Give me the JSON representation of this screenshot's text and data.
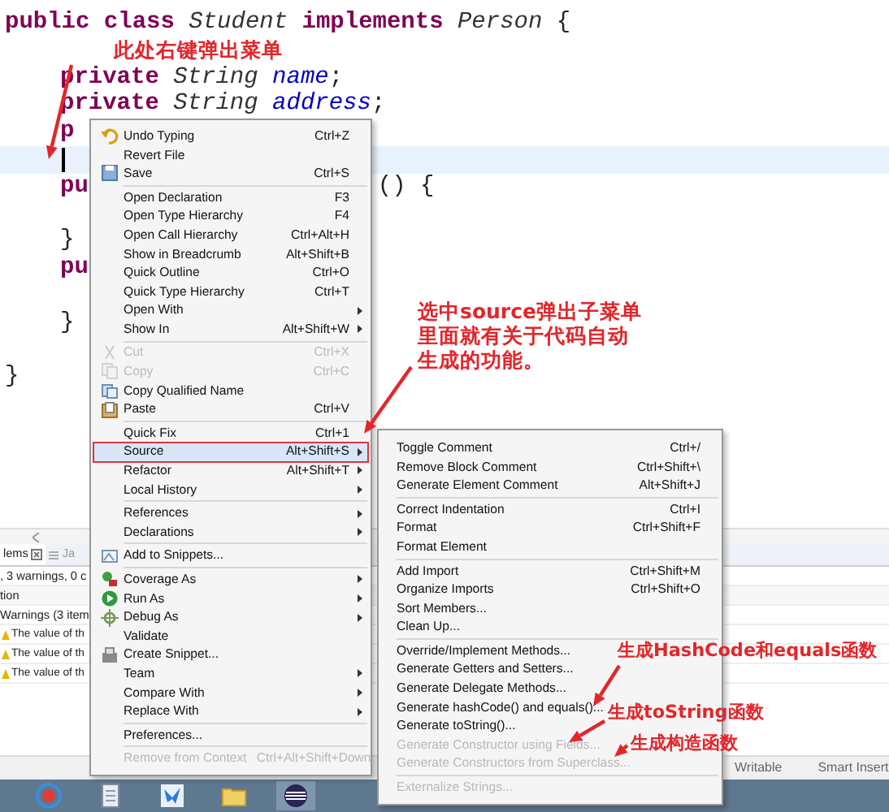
{
  "editor": {
    "lines": [
      {
        "tokens": [
          {
            "text": "public ",
            "kind": "keyword"
          },
          {
            "text": "class ",
            "kind": "keyword"
          },
          {
            "text": "Student ",
            "kind": "type"
          },
          {
            "text": "implements ",
            "kind": "keyword"
          },
          {
            "text": "Person ",
            "kind": "type"
          },
          {
            "text": "{",
            "kind": "plain"
          }
        ]
      },
      {
        "gap_before": true,
        "indented": true,
        "tokens": [
          {
            "text": "private ",
            "kind": "keyword"
          },
          {
            "text": "String ",
            "kind": "type"
          },
          {
            "text": "name",
            "kind": "field"
          },
          {
            "text": ";",
            "kind": "plain"
          }
        ]
      },
      {
        "indented": true,
        "tokens": [
          {
            "text": "private ",
            "kind": "keyword"
          },
          {
            "text": "String ",
            "kind": "type"
          },
          {
            "text": "address",
            "kind": "field"
          },
          {
            "text": ";",
            "kind": "plain"
          }
        ]
      },
      {
        "indented": true,
        "tokens": [
          {
            "text": "p",
            "kind": "keyword"
          }
        ]
      },
      {
        "current": true
      },
      {
        "indented": true,
        "tokens": [
          {
            "text": "pu",
            "kind": "keyword"
          }
        ],
        "after_menu": [
          {
            "text": "() {",
            "kind": "plain"
          }
        ]
      },
      {
        "gap_before": true,
        "indented": true,
        "tokens": [
          {
            "text": "}",
            "kind": "plain"
          }
        ]
      },
      {
        "indented": true,
        "tokens": [
          {
            "text": "pu",
            "kind": "keyword"
          }
        ]
      },
      {
        "gap_before": true,
        "indented": true,
        "tokens": [
          {
            "text": "}",
            "kind": "plain"
          }
        ]
      },
      {
        "gap_before": true,
        "tokens": [
          {
            "text": "}",
            "kind": "plain"
          }
        ]
      }
    ]
  },
  "context_menu": {
    "groups": [
      [
        {
          "label": "Undo Typing",
          "shortcut": "Ctrl+Z",
          "disabled": false,
          "selected": false,
          "submenu": false
        },
        {
          "label": "Revert File",
          "disabled": false,
          "selected": false,
          "submenu": false
        },
        {
          "label": "Save",
          "shortcut": "Ctrl+S",
          "disabled": false,
          "selected": false,
          "submenu": false
        }
      ],
      [
        {
          "label": "Open Declaration",
          "shortcut": "F3",
          "disabled": false,
          "selected": false,
          "submenu": false
        },
        {
          "label": "Open Type Hierarchy",
          "shortcut": "F4",
          "disabled": false,
          "selected": false,
          "submenu": false
        },
        {
          "label": "Open Call Hierarchy",
          "shortcut": "Ctrl+Alt+H",
          "disabled": false,
          "selected": false,
          "submenu": false
        },
        {
          "label": "Show in Breadcrumb",
          "shortcut": "Alt+Shift+B",
          "disabled": false,
          "selected": false,
          "submenu": false
        },
        {
          "label": "Quick Outline",
          "shortcut": "Ctrl+O",
          "disabled": false,
          "selected": false,
          "submenu": false
        },
        {
          "label": "Quick Type Hierarchy",
          "shortcut": "Ctrl+T",
          "disabled": false,
          "selected": false,
          "submenu": false
        },
        {
          "label": "Open With",
          "disabled": false,
          "selected": false,
          "submenu": true
        },
        {
          "label": "Show In",
          "shortcut": "Alt+Shift+W",
          "disabled": false,
          "selected": false,
          "submenu": true
        }
      ],
      [
        {
          "label": "Cut",
          "shortcut": "Ctrl+X",
          "disabled": true,
          "selected": false,
          "submenu": false
        },
        {
          "label": "Copy",
          "shortcut": "Ctrl+C",
          "disabled": true,
          "selected": false,
          "submenu": false
        },
        {
          "label": "Copy Qualified Name",
          "disabled": false,
          "selected": false,
          "submenu": false
        },
        {
          "label": "Paste",
          "shortcut": "Ctrl+V",
          "disabled": false,
          "selected": false,
          "submenu": false
        }
      ],
      [
        {
          "label": "Quick Fix",
          "shortcut": "Ctrl+1",
          "disabled": false,
          "selected": false,
          "submenu": false
        },
        {
          "label": "Source",
          "shortcut": "Alt+Shift+S",
          "disabled": false,
          "selected": true,
          "submenu": true
        },
        {
          "label": "Refactor",
          "shortcut": "Alt+Shift+T",
          "disabled": false,
          "selected": false,
          "submenu": true
        },
        {
          "label": "Local History",
          "disabled": false,
          "selected": false,
          "submenu": true
        }
      ],
      [
        {
          "label": "References",
          "disabled": false,
          "selected": false,
          "submenu": true
        },
        {
          "label": "Declarations",
          "disabled": false,
          "selected": false,
          "submenu": true
        }
      ],
      [
        {
          "label": "Add to Snippets...",
          "disabled": false,
          "selected": false,
          "submenu": false
        }
      ],
      [
        {
          "label": "Coverage As",
          "disabled": false,
          "selected": false,
          "submenu": true
        },
        {
          "label": "Run As",
          "disabled": false,
          "selected": false,
          "submenu": true
        },
        {
          "label": "Debug As",
          "disabled": false,
          "selected": false,
          "submenu": true
        },
        {
          "label": "Validate",
          "disabled": false,
          "selected": false,
          "submenu": false
        },
        {
          "label": "Create Snippet...",
          "disabled": false,
          "selected": false,
          "submenu": false
        },
        {
          "label": "Team",
          "disabled": false,
          "selected": false,
          "submenu": true
        },
        {
          "label": "Compare With",
          "disabled": false,
          "selected": false,
          "submenu": true
        },
        {
          "label": "Replace With",
          "disabled": false,
          "selected": false,
          "submenu": true
        }
      ],
      [
        {
          "label": "Preferences...",
          "disabled": false,
          "selected": false,
          "submenu": false
        }
      ],
      [
        {
          "label": "Remove from Context",
          "shortcut": "Ctrl+Alt+Shift+Down",
          "disabled": true,
          "selected": false
        }
      ]
    ]
  },
  "source_submenu": {
    "groups": [
      [
        {
          "label": "Toggle Comment",
          "shortcut": "Ctrl+/",
          "disabled": false
        },
        {
          "label": "Remove Block Comment",
          "shortcut": "Ctrl+Shift+\\",
          "disabled": false
        },
        {
          "label": "Generate Element Comment",
          "shortcut": "Alt+Shift+J",
          "disabled": false
        }
      ],
      [
        {
          "label": "Correct Indentation",
          "shortcut": "Ctrl+I",
          "disabled": false
        },
        {
          "label": "Format",
          "shortcut": "Ctrl+Shift+F",
          "disabled": false
        },
        {
          "label": "Format Element",
          "disabled": false
        }
      ],
      [
        {
          "label": "Add Import",
          "shortcut": "Ctrl+Shift+M",
          "disabled": false
        },
        {
          "label": "Organize Imports",
          "shortcut": "Ctrl+Shift+O",
          "disabled": false
        },
        {
          "label": "Sort Members...",
          "disabled": false
        },
        {
          "label": "Clean Up...",
          "disabled": false
        }
      ],
      [
        {
          "label": "Override/Implement Methods...",
          "disabled": false
        },
        {
          "label": "Generate Getters and Setters...",
          "disabled": false
        },
        {
          "label": "Generate Delegate Methods...",
          "disabled": false
        },
        {
          "label": "Generate hashCode() and equals()...",
          "disabled": false
        },
        {
          "label": "Generate toString()...",
          "disabled": false
        },
        {
          "label": "Generate Constructor using Fields...",
          "disabled": true
        },
        {
          "label": "Generate Constructors from Superclass...",
          "disabled": true
        }
      ],
      [
        {
          "label": "Externalize Strings...",
          "disabled": true
        }
      ]
    ]
  },
  "problems_panel": {
    "tabs": [
      {
        "label": "lems",
        "selected": true
      },
      {
        "label": "Ja",
        "selected": false
      }
    ],
    "summary": ", 3 warnings, 0 c",
    "column_header": "tion",
    "tree": [
      {
        "label": "Warnings (3 item",
        "children": [
          {
            "label": "The value of th"
          },
          {
            "label": "The value of th"
          },
          {
            "label": "The value of th"
          }
        ]
      }
    ]
  },
  "status_bar": {
    "items": [
      "Writable",
      "Smart Insert"
    ]
  },
  "annotations": [
    {
      "lines": [
        "此处右键弹出菜单"
      ]
    },
    {
      "lines": [
        "选中source弹出子菜单",
        "里面就有关于代码自动",
        "生成的功能。"
      ]
    },
    {
      "lines": [
        "生成HashCode和equals函数"
      ]
    },
    {
      "lines": [
        "生成toString函数"
      ]
    },
    {
      "lines": [
        "生成构造函数"
      ]
    }
  ]
}
